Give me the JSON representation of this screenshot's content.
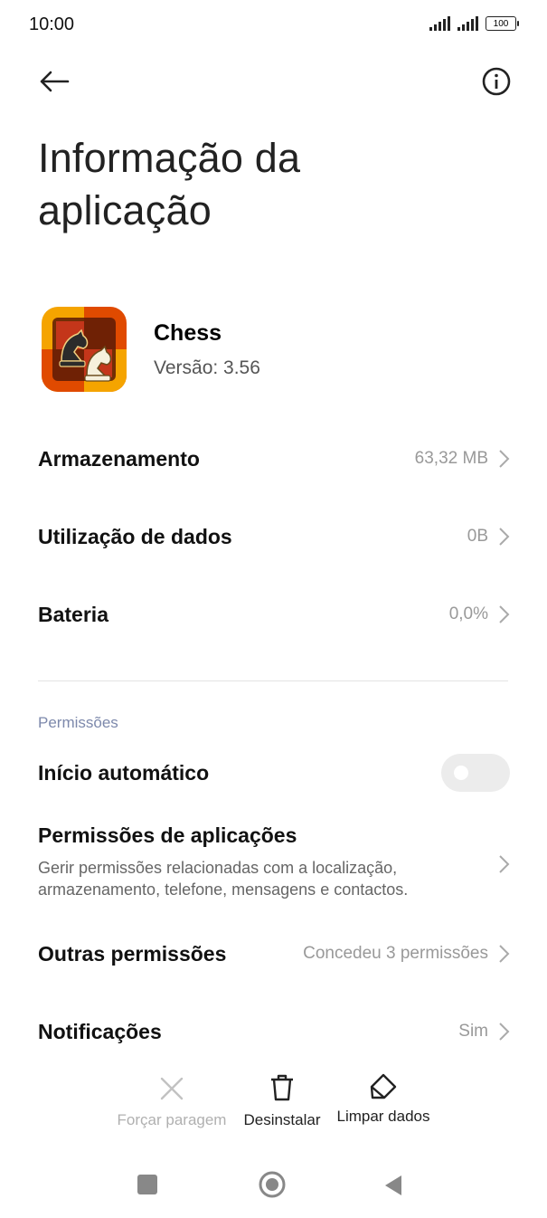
{
  "status_bar": {
    "time": "10:00",
    "battery": "100"
  },
  "header": {
    "title_line1": "Informação da",
    "title_line2": "aplicação"
  },
  "app": {
    "name": "Chess",
    "version": "Versão: 3.56"
  },
  "rows": {
    "storage": {
      "label": "Armazenamento",
      "value": "63,32 MB"
    },
    "data_usage": {
      "label": "Utilização de dados",
      "value": "0B"
    },
    "battery": {
      "label": "Bateria",
      "value": "0,0%"
    }
  },
  "permissions_section": {
    "title": "Permissões",
    "autostart": {
      "label": "Início automático",
      "enabled": false
    },
    "app_permissions": {
      "label": "Permissões de aplicações",
      "desc1": "Gerir permissões relacionadas com a localização,",
      "desc2": "armazenamento, telefone, mensagens e contactos."
    },
    "other_permissions": {
      "label": "Outras permissões",
      "value": "Concedeu 3 permissões"
    },
    "notifications": {
      "label": "Notificações",
      "value": "Sim"
    }
  },
  "actions": {
    "force_stop": "Forçar paragem",
    "uninstall": "Desinstalar",
    "clear_data": "Limpar dados"
  },
  "colors": {
    "accent_section": "#7d89ac",
    "disabled_text": "#b0b0b0"
  }
}
